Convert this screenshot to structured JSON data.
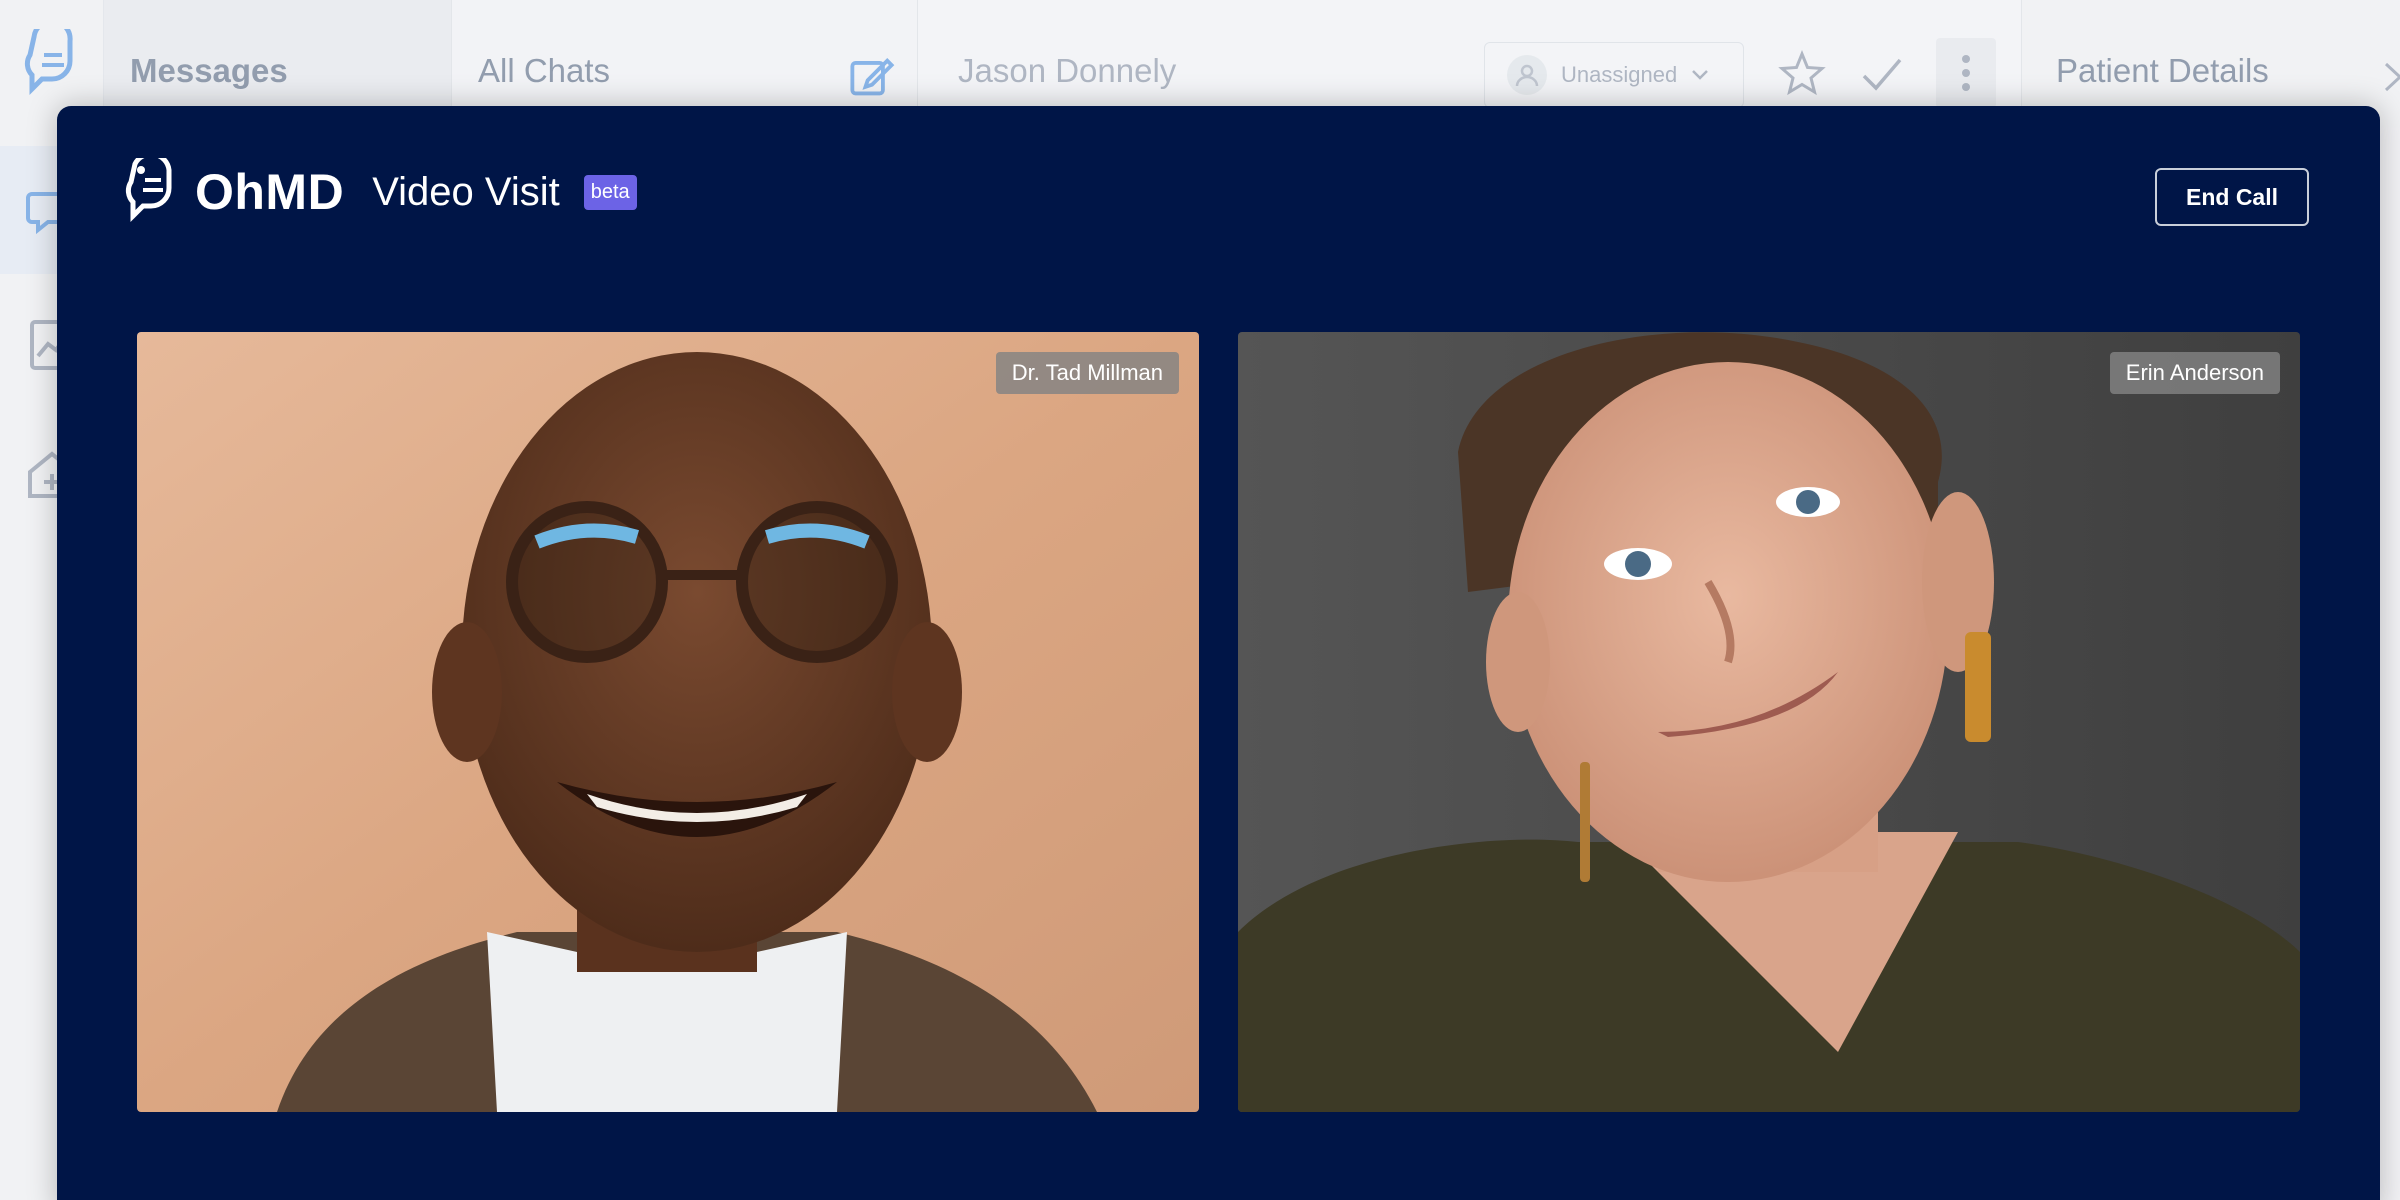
{
  "app": {
    "messages_title": "Messages",
    "all_chats_title": "All Chats",
    "contact_name": "Jason Donnely",
    "assignee": "Unassigned",
    "details_title": "Patient Details"
  },
  "modal": {
    "brand": "OhMD",
    "title": "Video Visit",
    "badge": "beta",
    "end_call_label": "End Call"
  },
  "participants": [
    {
      "name": "Dr. Tad Millman"
    },
    {
      "name": "Erin Anderson"
    }
  ],
  "colors": {
    "modal_bg": "#001547",
    "beta_badge": "#6c63e6",
    "accent": "#4a90e2"
  }
}
